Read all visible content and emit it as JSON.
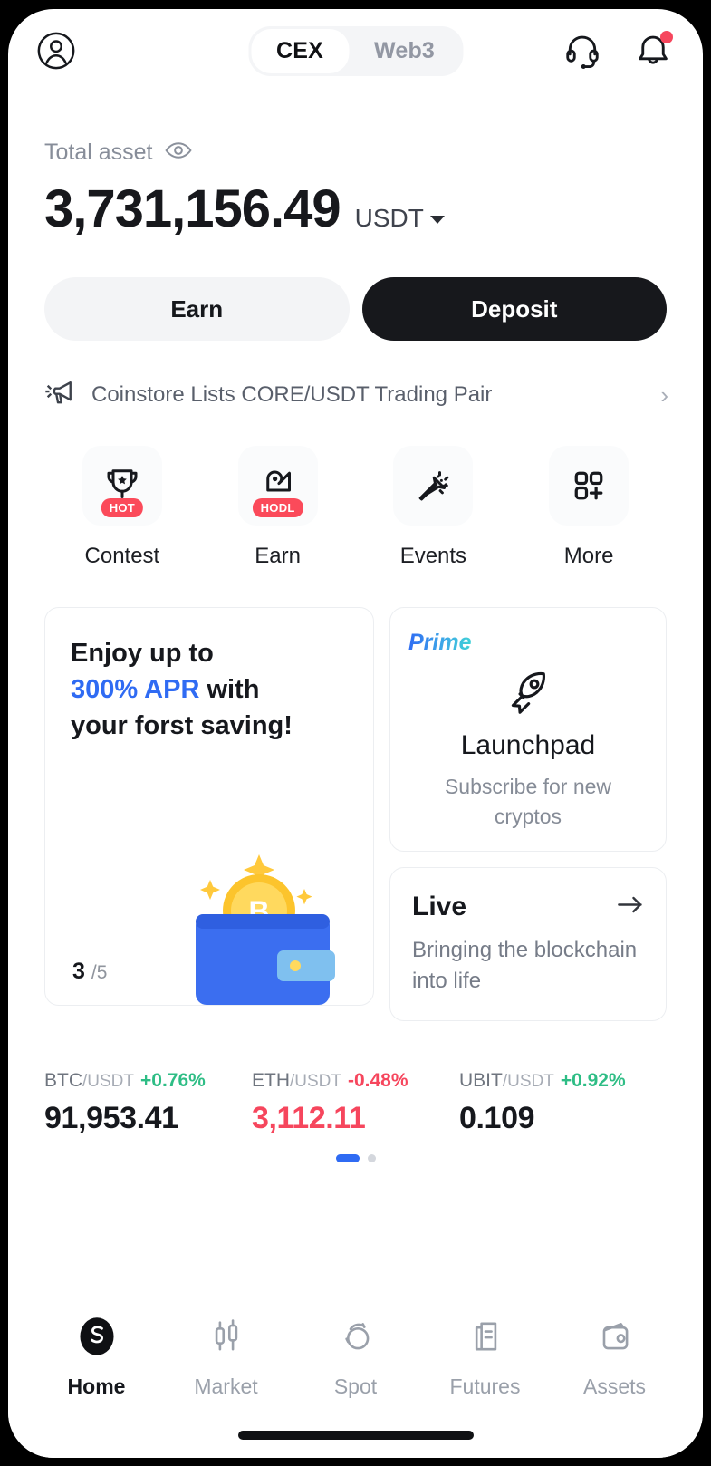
{
  "topbar": {
    "avatar_icon": "user-circle-icon",
    "segments": [
      {
        "label": "CEX",
        "active": true
      },
      {
        "label": "Web3",
        "active": false
      }
    ],
    "support_icon": "headset-icon",
    "notifications_icon": "bell-icon",
    "notification_dot": true
  },
  "balance": {
    "label": "Total asset",
    "visibility_icon": "eye-icon",
    "amount": "3,731,156.49",
    "currency": "USDT",
    "currency_caret_icon": "caret-down-icon"
  },
  "actions": {
    "earn_label": "Earn",
    "deposit_label": "Deposit"
  },
  "announcement": {
    "icon": "megaphone-icon",
    "text": "Coinstore Lists CORE/USDT Trading Pair",
    "chevron": "›"
  },
  "quick_actions": [
    {
      "label": "Contest",
      "icon": "trophy-icon",
      "badge": "HOT"
    },
    {
      "label": "Earn",
      "icon": "piggy-hand-icon",
      "badge": "HODL"
    },
    {
      "label": "Events",
      "icon": "party-popper-icon",
      "badge": ""
    },
    {
      "label": "More",
      "icon": "grid-plus-icon",
      "badge": ""
    }
  ],
  "promo_card": {
    "line1": "Enjoy up to",
    "accent": "300% APR",
    "line2_tail": " with",
    "line3": "your forst saving!",
    "page_current": "3",
    "page_total": "/5",
    "art_icon": "wallet-bitcoin-illustration"
  },
  "launchpad_card": {
    "tag": "Prime",
    "icon": "rocket-icon",
    "title": "Launchpad",
    "subtitle": "Subscribe for new cryptos"
  },
  "live_card": {
    "title": "Live",
    "arrow_icon": "arrow-right-icon",
    "subtitle": "Bringing the blockchain into life"
  },
  "tickers": [
    {
      "base": "BTC",
      "quote": "/USDT",
      "change": "+0.76%",
      "direction": "up",
      "price": "91,953.41"
    },
    {
      "base": "ETH",
      "quote": "/USDT",
      "change": "-0.48%",
      "direction": "down",
      "price": "3,112.11"
    },
    {
      "base": "UBIT",
      "quote": "/USDT",
      "change": "+0.92%",
      "direction": "up",
      "price": "0.109"
    }
  ],
  "ticker_pagination": {
    "total": 2,
    "active_index": 0
  },
  "bottom_nav": [
    {
      "label": "Home",
      "icon": "coinstore-logo-icon",
      "active": true
    },
    {
      "label": "Market",
      "icon": "candlestick-icon",
      "active": false
    },
    {
      "label": "Spot",
      "icon": "spot-trade-icon",
      "active": false
    },
    {
      "label": "Futures",
      "icon": "futures-doc-icon",
      "active": false
    },
    {
      "label": "Assets",
      "icon": "wallet-icon",
      "active": false
    }
  ],
  "colors": {
    "up": "#2ebd85",
    "down": "#f6465d",
    "accent_blue": "#2f6bf3",
    "badge_red": "#fb4a5a",
    "dark": "#17181c"
  }
}
